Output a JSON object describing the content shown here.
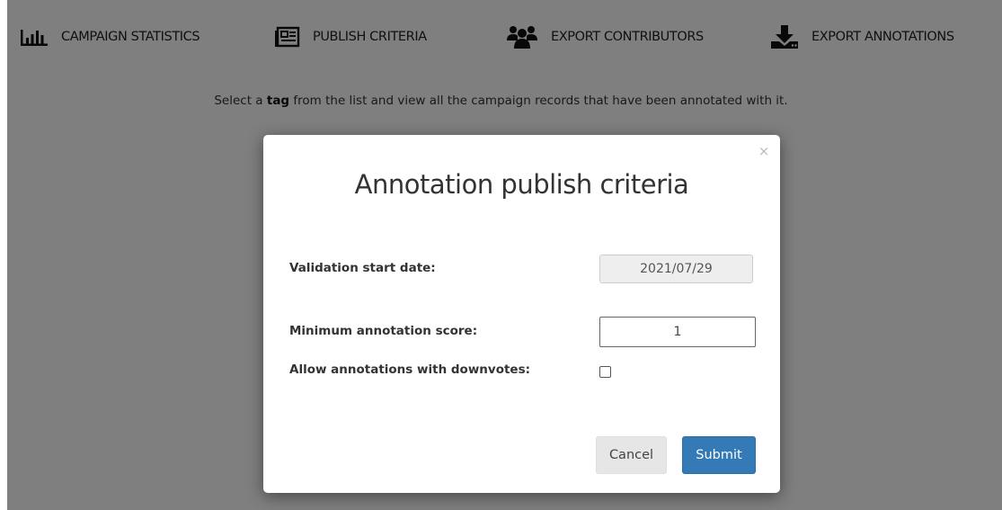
{
  "nav": {
    "items": [
      {
        "label": "CAMPAIGN STATISTICS",
        "icon": "bar-chart-icon"
      },
      {
        "label": "PUBLISH CRITERIA",
        "icon": "newspaper-icon"
      },
      {
        "label": "EXPORT CONTRIBUTORS",
        "icon": "users-icon"
      },
      {
        "label": "EXPORT ANNOTATIONS",
        "icon": "download-icon"
      }
    ]
  },
  "helper": {
    "prefix": "Select a ",
    "keyword": "tag",
    "suffix": " from the list and view all the campaign records that have been annotated with it."
  },
  "modal": {
    "close_symbol": "×",
    "title": "Annotation publish criteria",
    "fields": {
      "validation_start_date": {
        "label": "Validation start date:",
        "value": "2021/07/29"
      },
      "minimum_annotation_score": {
        "label": "Minimum annotation score:",
        "value": "1"
      },
      "allow_downvotes": {
        "label": "Allow annotations with downvotes:",
        "checked": false
      }
    },
    "buttons": {
      "cancel": "Cancel",
      "submit": "Submit"
    }
  },
  "colors": {
    "primary": "#337ab7",
    "backdrop": "rgba(0,0,0,0.5)",
    "text": "#333333"
  }
}
